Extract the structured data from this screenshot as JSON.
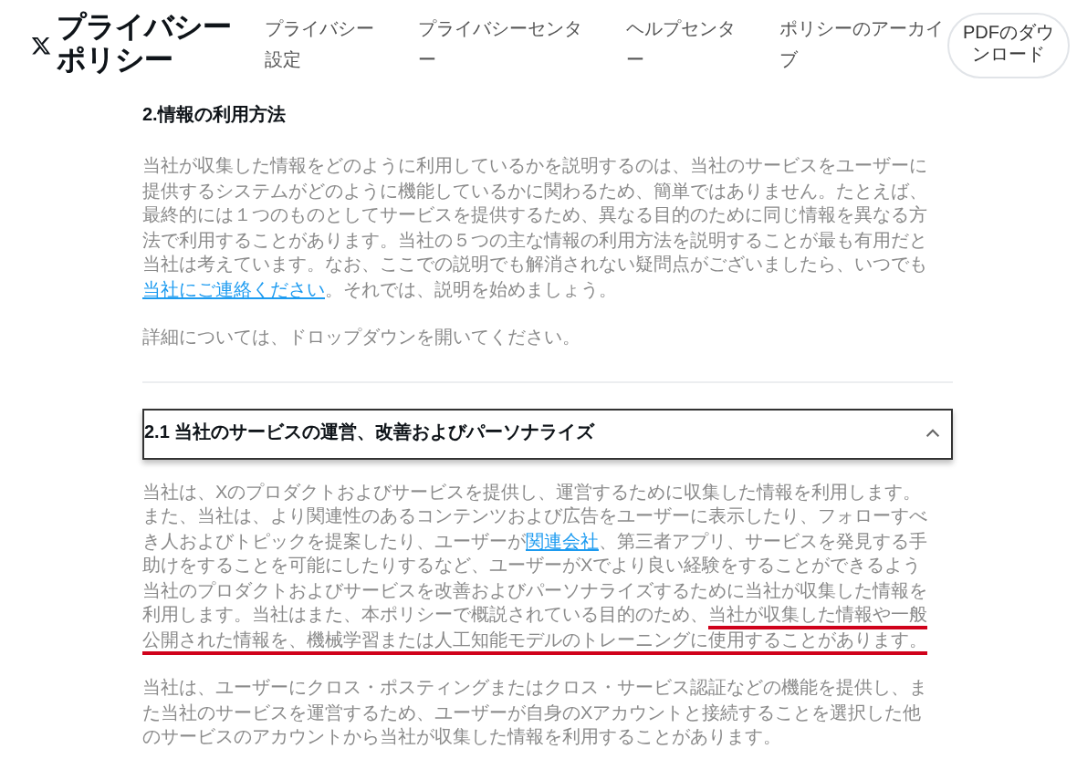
{
  "header": {
    "title": "プライバシーポリシー",
    "nav": [
      "プライバシー設定",
      "プライバシーセンター",
      "ヘルプセンター",
      "ポリシーのアーカイブ"
    ],
    "button": "PDFのダウンロード"
  },
  "section": {
    "heading": "2.情報の利用方法",
    "intro": [
      {
        "segments": [
          {
            "kind": "text",
            "text": "当社が収集した情報をどのように利用しているかを説明するのは、当社のサービスをユーザーに提供するシステムがどのように機能しているかに関わるため、簡単ではありません。たとえば、最終的には１つのものとしてサービスを提供するため、異なる目的のために同じ情報を異なる方法で利用することがあります。当社の５つの主な情報の利用方法を説明することが最も有用だと当社は考えています。なお、ここでの説明でも解消されない疑問点がございましたら、いつでも"
          },
          {
            "kind": "link",
            "text": "当社にご連絡ください"
          },
          {
            "kind": "text",
            "text": "。それでは、説明を始めましょう。"
          }
        ]
      },
      {
        "segments": [
          {
            "kind": "text",
            "text": "詳細については、ドロップダウンを開いてください。"
          }
        ]
      }
    ],
    "accordion": {
      "title": "2.1 当社のサービスの運営、改善およびパーソナライズ",
      "expanded": true,
      "paragraphs": [
        {
          "segments": [
            {
              "kind": "text",
              "text": "当社は、Xのプロダクトおよびサービスを提供し、運営するために収集した情報を利用します。また、当社は、より関連性のあるコンテンツおよび広告をユーザーに表示したり、フォローすべき人およびトピックを提案したり、ユーザーが"
            },
            {
              "kind": "link",
              "text": "関連会社"
            },
            {
              "kind": "text",
              "text": "、第三者アプリ、サービスを発見する手助けをすることを可能にしたりするなど、ユーザーがXでより良い経験をすることができるよう当社のプロダクトおよびサービスを改善およびパーソナライズするために当社が収集した情報を利用します。当社はまた、本ポリシーで概説されている目的のため、"
            },
            {
              "kind": "marked",
              "text": "当社が収集した情報や一般公開された情報を、機械学習または人工知能モデルのトレーニングに使用することがあります。"
            }
          ]
        },
        {
          "segments": [
            {
              "kind": "text",
              "text": "当社は、ユーザーにクロス・ポスティングまたはクロス・サービス認証などの機能を提供し、また当社のサービスを運営するため、ユーザーが自身のXアカウントと接続することを選択した他のサービスのアカウントから当社が収集した情報を利用することがあります。"
            }
          ]
        }
      ]
    }
  }
}
